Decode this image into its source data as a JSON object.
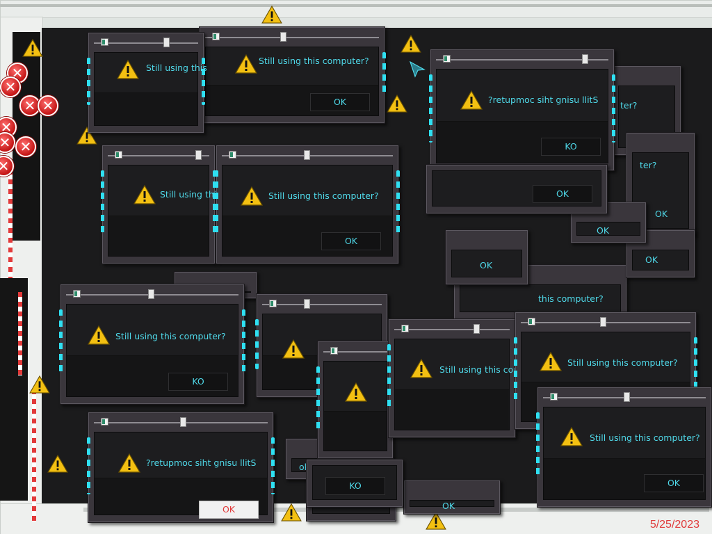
{
  "dialogs": [
    {
      "message": "Still using this computer?",
      "button": "OK"
    },
    {
      "message": "Still using this",
      "button": "OK"
    },
    {
      "message": "Still using this computer?",
      "button": "KO"
    },
    {
      "message": "Still using thi",
      "button": "OK"
    },
    {
      "message": "Still using this computer?",
      "button": "OK"
    },
    {
      "message": "?retupmoc siht gnisu llitS",
      "button": "KO"
    },
    {
      "message": "Still using this computer?",
      "button": "KO"
    },
    {
      "message": "Still using this com",
      "button": "OK"
    },
    {
      "message": "Still using this computer?",
      "button": "OK"
    },
    {
      "message": "Still using this computer?",
      "button": "OK"
    },
    {
      "message": "?retupmoc siht gnisu llitS",
      "button": "OK"
    }
  ],
  "fragments": [
    {
      "message": "this computer?"
    },
    {
      "message": "ter?"
    },
    {
      "message": "ter?"
    },
    {
      "message": "ok"
    },
    {
      "message": "OK"
    },
    {
      "message": "OK"
    },
    {
      "message": "OK"
    },
    {
      "message": "KO"
    },
    {
      "message": "OK"
    },
    {
      "message": "ok"
    },
    {
      "message": "OK"
    }
  ],
  "footer": {
    "date": "5/25/2023"
  },
  "icons": {
    "warning": "warning-icon",
    "error": "error-icon",
    "cursor": "cursor-icon"
  },
  "colors": {
    "text_cyan": "#4fd8e8",
    "neon": "#2fe0f2",
    "error_red": "#e23a3a",
    "warning_yellow": "#f3c012",
    "dialog_frame": "#3a363c"
  }
}
